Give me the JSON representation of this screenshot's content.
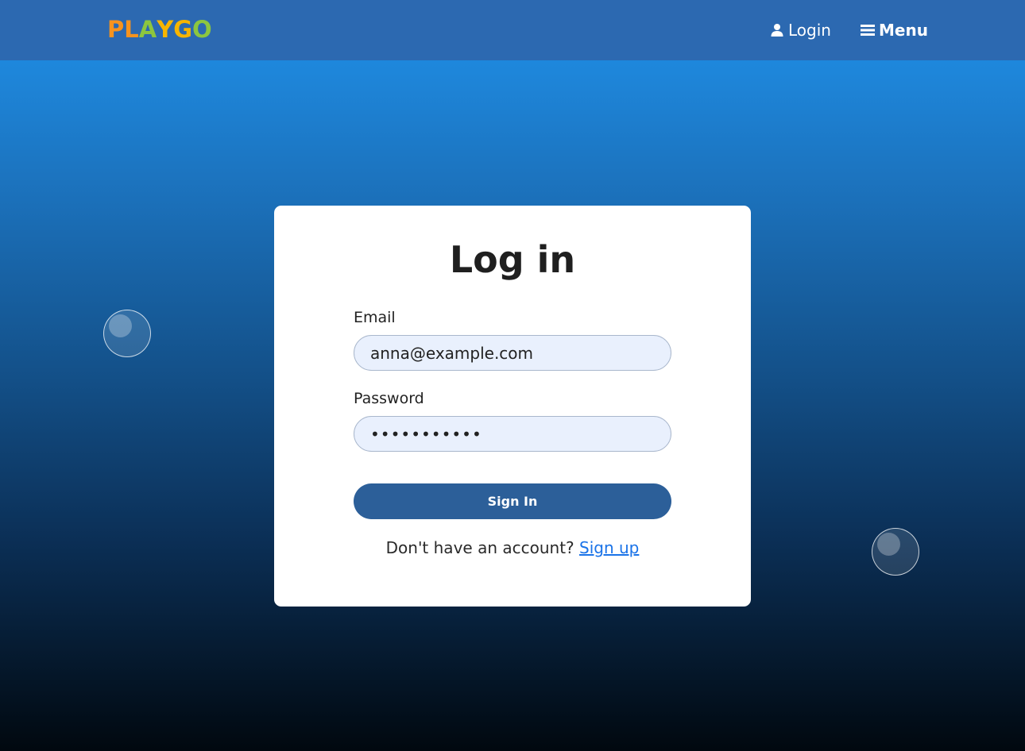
{
  "header": {
    "logo_text": "PLAYGO",
    "logo_letters": [
      {
        "char": "P",
        "color": "#f7931e"
      },
      {
        "char": "L",
        "color": "#f7931e"
      },
      {
        "char": "A",
        "color": "#8cc63f"
      },
      {
        "char": "Y",
        "color": "#f7b500"
      },
      {
        "char": "G",
        "color": "#f7b500"
      },
      {
        "char": "O",
        "color": "#8cc63f"
      }
    ],
    "login_label": "Login",
    "menu_label": "Menu",
    "login_icon": "user-icon",
    "menu_icon": "hamburger-icon",
    "bg_color": "#2c69b1"
  },
  "login_form": {
    "title": "Log in",
    "email_label": "Email",
    "email_value": "anna@example.com",
    "password_label": "Password",
    "password_value": "•••••••••••",
    "submit_label": "Sign In",
    "signup_prompt": "Don't have an account?",
    "signup_link": "Sign up"
  },
  "colors": {
    "button": "#2c5f99",
    "link": "#1a73e8",
    "input_bg": "#e9f0fd"
  }
}
